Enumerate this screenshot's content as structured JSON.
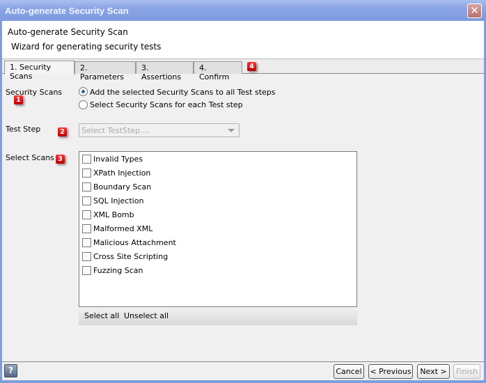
{
  "window": {
    "title": "Auto-generate Security Scan",
    "close_icon": "close-icon"
  },
  "header": {
    "title": "Auto-generate Security Scan",
    "subtitle": "Wizard for generating security tests"
  },
  "tabs": [
    {
      "label": "1. Security Scans",
      "active": true
    },
    {
      "label": "2. Parameters"
    },
    {
      "label": "3. Assertions"
    },
    {
      "label": "4. Confirm"
    }
  ],
  "badges": [
    "1",
    "2",
    "3",
    "4"
  ],
  "form": {
    "security_scans_label": "Security Scans",
    "radio_options": [
      {
        "label": "Add the selected Security Scans to all Test steps",
        "selected": true
      },
      {
        "label": "Select Security Scans for each Test step",
        "selected": false
      }
    ],
    "test_step_label": "Test Step",
    "test_step_placeholder": "Select TestStep....",
    "select_scans_label": "Select Scans",
    "scans": [
      "Invalid Types",
      "XPath Injection",
      "Boundary Scan",
      "SQL Injection",
      "XML Bomb",
      "Malformed XML",
      "Malicious Attachment",
      "Cross Site Scripting",
      "Fuzzing Scan"
    ],
    "select_all": "Select all",
    "unselect_all": "Unselect all"
  },
  "footer": {
    "help": "?",
    "cancel": "Cancel",
    "previous": "< Previous",
    "next": "Next >",
    "finish": "Finish"
  },
  "colors": {
    "titlebar": "#7e9adf",
    "badge": "#cc0000"
  }
}
